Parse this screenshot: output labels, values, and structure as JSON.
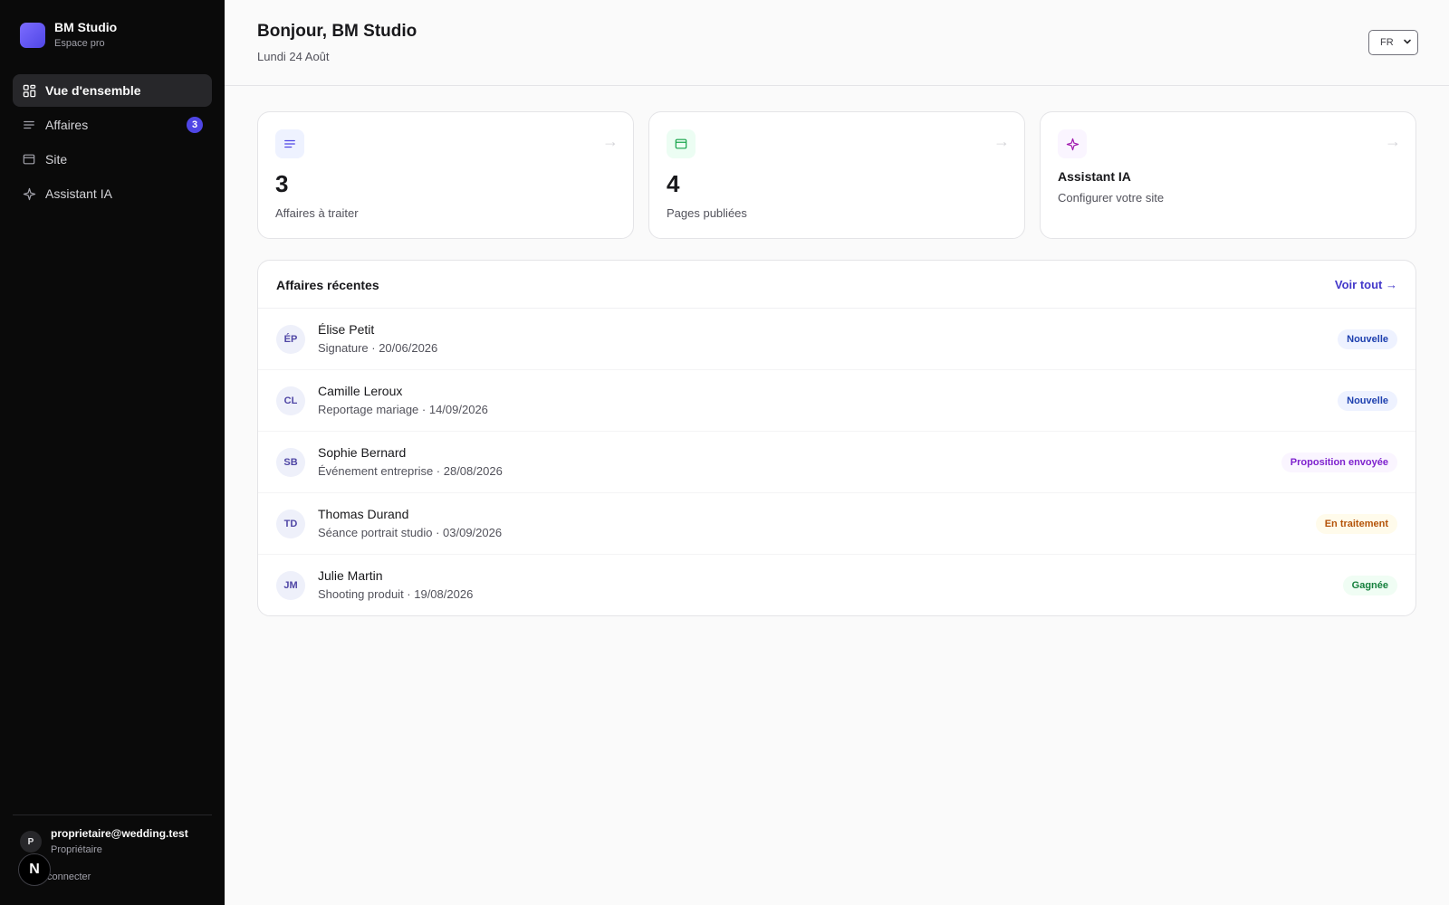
{
  "brand": {
    "name": "BM Studio",
    "subtitle": "Espace pro"
  },
  "nav": [
    {
      "label": "Vue d'ensemble",
      "icon": "grid-icon",
      "active": true
    },
    {
      "label": "Affaires",
      "icon": "list-icon",
      "badge": "3"
    },
    {
      "label": "Site",
      "icon": "browser-icon"
    },
    {
      "label": "Assistant IA",
      "icon": "sparkle-icon"
    }
  ],
  "user": {
    "initial": "P",
    "email": "proprietaire@wedding.test",
    "role": "Propriétaire",
    "logout_label": "connecter",
    "overlay_badge": "N"
  },
  "header": {
    "greeting": "Bonjour, BM Studio",
    "date": "Lundi 24 Août",
    "language": "FR"
  },
  "cards": [
    {
      "value": "3",
      "label": "Affaires à traiter",
      "icon": "list-icon",
      "arrow": "→"
    },
    {
      "value": "4",
      "label": "Pages publiées",
      "icon": "browser-icon",
      "arrow": "→"
    },
    {
      "title": "Assistant IA",
      "subtitle": "Configurer votre site",
      "icon": "sparkle-icon",
      "arrow": "→"
    }
  ],
  "recent": {
    "title": "Affaires récentes",
    "view_all": "Voir tout →",
    "rows": [
      {
        "initials": "ÉP",
        "name": "Élise Petit",
        "meta": "Signature · 20/06/2026",
        "status": "Nouvelle",
        "status_bg": "#eef2ff",
        "status_color": "#1e40af"
      },
      {
        "initials": "CL",
        "name": "Camille Leroux",
        "meta": "Reportage mariage · 14/09/2026",
        "status": "Nouvelle",
        "status_bg": "#eef2ff",
        "status_color": "#1e40af"
      },
      {
        "initials": "SB",
        "name": "Sophie Bernard",
        "meta": "Événement entreprise · 28/08/2026",
        "status": "Proposition envoyée",
        "status_bg": "#faf5ff",
        "status_color": "#7e22ce"
      },
      {
        "initials": "TD",
        "name": "Thomas Durand",
        "meta": "Séance portrait studio · 03/09/2026",
        "status": "En traitement",
        "status_bg": "#fffbeb",
        "status_color": "#b45309"
      },
      {
        "initials": "JM",
        "name": "Julie Martin",
        "meta": "Shooting produit · 19/08/2026",
        "status": "Gagnée",
        "status_bg": "#f0fdf4",
        "status_color": "#15803d"
      }
    ]
  },
  "colors": {
    "accent": "#4f46e5",
    "sidebar_bg": "#0a0a0a"
  }
}
